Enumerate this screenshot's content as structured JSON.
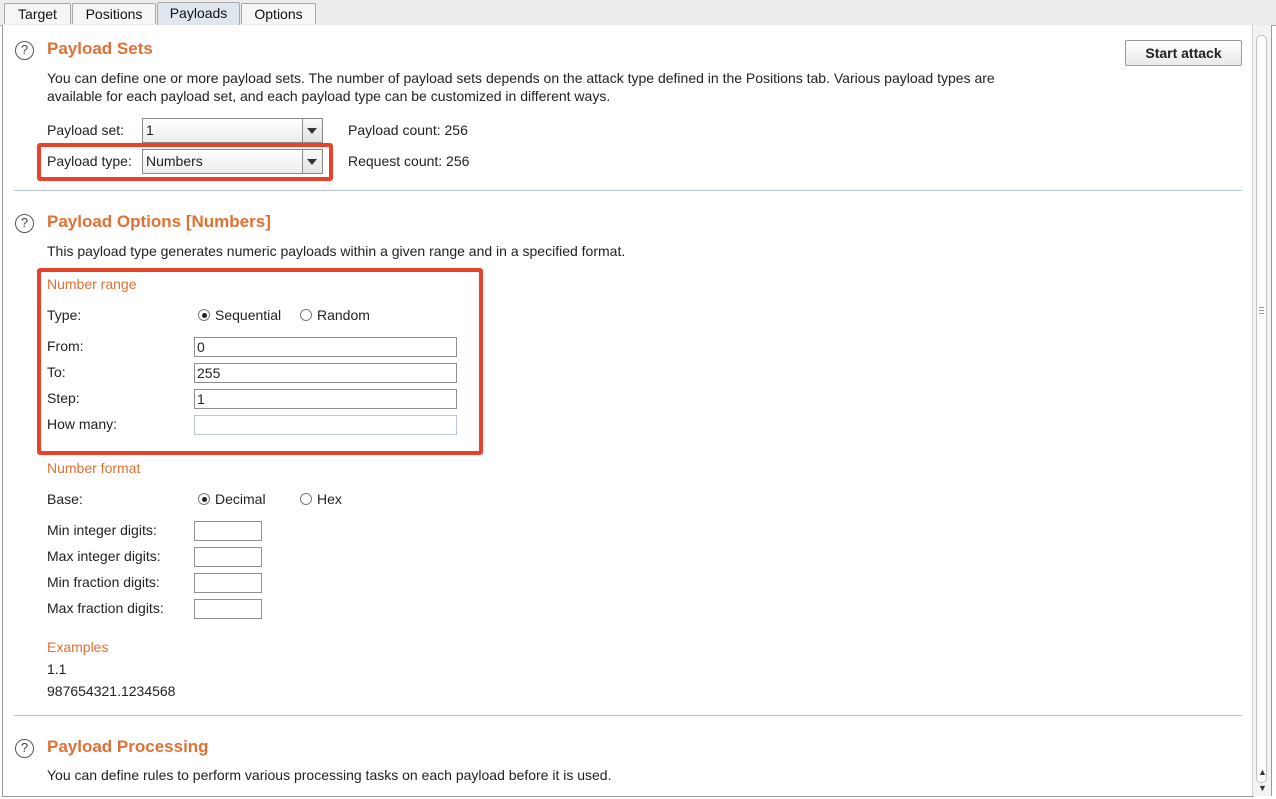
{
  "tabs": [
    "Target",
    "Positions",
    "Payloads",
    "Options"
  ],
  "active_tab": "Payloads",
  "payload_sets": {
    "title": "Payload Sets",
    "description_line1": "You can define one or more payload sets. The number of payload sets depends on the attack type defined in the Positions tab. Various payload types are",
    "description_line2": "available for each payload set, and each payload type can be customized in different ways.",
    "start_attack_label": "Start attack",
    "payload_set_label": "Payload set:",
    "payload_set_value": "1",
    "payload_type_label": "Payload type:",
    "payload_type_value": "Numbers",
    "payload_count": "Payload count:  256",
    "request_count": "Request count:  256"
  },
  "payload_options": {
    "title": "Payload Options [Numbers]",
    "description": "This payload type generates numeric payloads within a given range and in a specified format.",
    "number_range": {
      "title": "Number range",
      "type_label": "Type:",
      "sequential_label": "Sequential",
      "random_label": "Random",
      "selected": "Sequential",
      "from_label": "From:",
      "from_value": "0",
      "to_label": "To:",
      "to_value": "255",
      "step_label": "Step:",
      "step_value": "1",
      "how_many_label": "How many:",
      "how_many_value": ""
    },
    "number_format": {
      "title": "Number format",
      "base_label": "Base:",
      "decimal_label": "Decimal",
      "hex_label": "Hex",
      "selected": "Decimal",
      "min_integer_label": "Min integer digits:",
      "max_integer_label": "Max integer digits:",
      "min_fraction_label": "Min fraction digits:",
      "max_fraction_label": "Max fraction digits:",
      "min_integer_value": "",
      "max_integer_value": "",
      "min_fraction_value": "",
      "max_fraction_value": ""
    },
    "examples": {
      "title": "Examples",
      "items": [
        "1.1",
        "987654321.1234568"
      ]
    }
  },
  "payload_processing": {
    "title": "Payload Processing",
    "description": "You can define rules to perform various processing tasks on each payload before it is used."
  },
  "help_icon_glyph": "?",
  "colors": {
    "section_title": "#e07034",
    "highlight_box": "#e8412c",
    "active_tab": "#dfe6ee"
  },
  "icons": [
    "help-icon",
    "dropdown-arrow-icon",
    "scroll-up-icon",
    "scroll-down-icon"
  ]
}
